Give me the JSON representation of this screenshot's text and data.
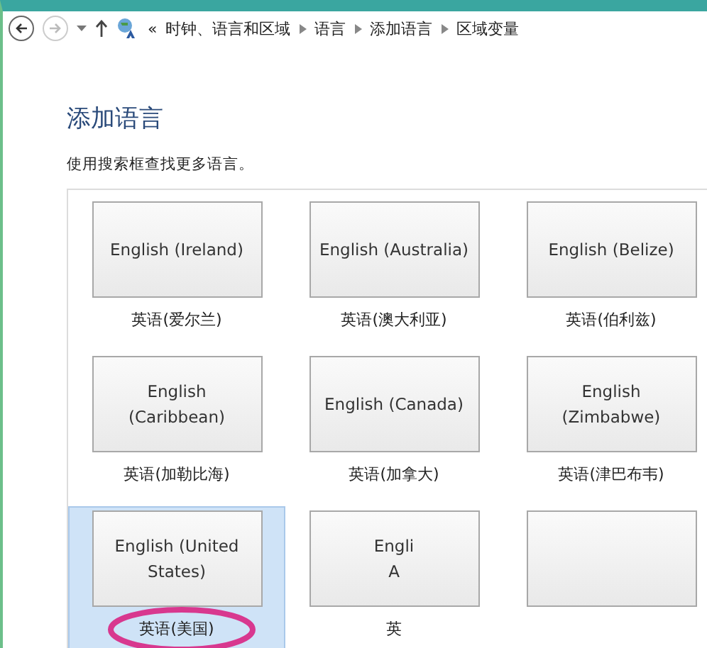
{
  "navigation": {
    "back_disabled": false,
    "forward_disabled": true,
    "overflow": "«",
    "breadcrumb": [
      "时钟、语言和区域",
      "语言",
      "添加语言",
      "区域变量"
    ]
  },
  "heading": "添加语言",
  "hint": "使用搜索框查找更多语言。",
  "languages": [
    {
      "lines": [
        "English (Ireland)"
      ],
      "label": "英语(爱尔兰)",
      "selected": false,
      "circled": false
    },
    {
      "lines": [
        "English (Australia)"
      ],
      "label": "英语(澳大利亚)",
      "selected": false,
      "circled": false
    },
    {
      "lines": [
        "English (Belize)"
      ],
      "label": "英语(伯利兹)",
      "selected": false,
      "circled": false
    },
    {
      "lines": [
        "English",
        "(Caribbean)"
      ],
      "label": "英语(加勒比海)",
      "selected": false,
      "circled": false
    },
    {
      "lines": [
        "English (Canada)"
      ],
      "label": "英语(加拿大)",
      "selected": false,
      "circled": false
    },
    {
      "lines": [
        "English",
        "(Zimbabwe)"
      ],
      "label": "英语(津巴布韦)",
      "selected": false,
      "circled": false
    },
    {
      "lines": [
        "English (United",
        "States)"
      ],
      "label": "英语(美国)",
      "selected": true,
      "circled": true
    },
    {
      "lines": [
        "Engli",
        "A"
      ],
      "label": "英",
      "selected": false,
      "circled": false
    },
    {
      "selected": false,
      "circled": false
    }
  ]
}
